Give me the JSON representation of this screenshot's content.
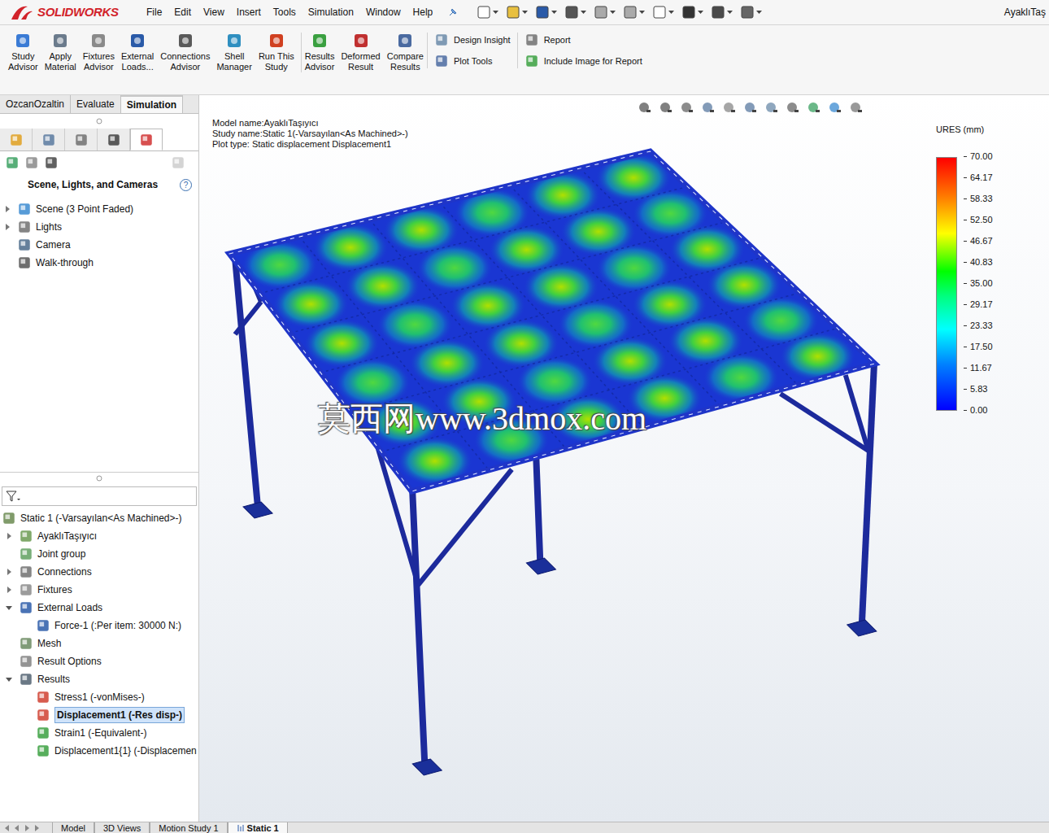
{
  "window": {
    "title": "AyaklıTaş"
  },
  "logo": {
    "brand": "SOLIDWORKS"
  },
  "menu": [
    "File",
    "Edit",
    "View",
    "Insert",
    "Tools",
    "Simulation",
    "Window",
    "Help"
  ],
  "ribbon": {
    "buttons": [
      {
        "lines": [
          "Study",
          "Advisor"
        ],
        "color": "#3a7bd5"
      },
      {
        "lines": [
          "Apply",
          "Material"
        ],
        "color": "#6b7b8c"
      },
      {
        "lines": [
          "Fixtures",
          "Advisor"
        ],
        "color": "#8a8a8a"
      },
      {
        "lines": [
          "External",
          "Loads..."
        ],
        "color": "#2a5aa8"
      },
      {
        "lines": [
          "Connections",
          "Advisor"
        ],
        "color": "#5a5a5a"
      },
      {
        "lines": [
          "Shell",
          "Manager"
        ],
        "color": "#2f8fc0"
      },
      {
        "lines": [
          "Run This",
          "Study"
        ],
        "color": "#d04020"
      },
      {
        "lines": [
          "Results",
          "Advisor"
        ],
        "color": "#3aa040"
      },
      {
        "lines": [
          "Deformed",
          "Result"
        ],
        "color": "#c03030"
      },
      {
        "lines": [
          "Compare",
          "Results"
        ],
        "color": "#4a6aa0"
      }
    ],
    "tools": [
      "Design Insight",
      "Plot Tools"
    ],
    "report": [
      "Report",
      "Include Image for Report"
    ]
  },
  "command_tabs": [
    {
      "label": "OzcanOzaltin",
      "selected": false
    },
    {
      "label": "Evaluate",
      "selected": false
    },
    {
      "label": "Simulation",
      "selected": true
    }
  ],
  "panel": {
    "tabs": [
      {
        "selected": false
      },
      {
        "selected": false
      },
      {
        "selected": false
      },
      {
        "selected": false
      },
      {
        "selected": true
      }
    ],
    "header": "Scene, Lights, and Cameras",
    "help": "?",
    "items": [
      {
        "label": "Scene (3 Point Faded)",
        "expandable": true,
        "expanded": false
      },
      {
        "label": "Lights",
        "expandable": true,
        "expanded": false
      },
      {
        "label": "Camera",
        "expandable": false,
        "expanded": false
      },
      {
        "label": "Walk-through",
        "expandable": false,
        "expanded": false
      }
    ]
  },
  "study_tree": [
    {
      "label": "Static 1 (-Varsayılan<As Machined>-)",
      "depth": 0,
      "expandable": false,
      "expanded": false,
      "selected": false
    },
    {
      "label": "AyaklıTaşıyıcı",
      "depth": 1,
      "expandable": true,
      "expanded": false,
      "selected": false
    },
    {
      "label": "Joint group",
      "depth": 1,
      "expandable": false,
      "expanded": false,
      "selected": false
    },
    {
      "label": "Connections",
      "depth": 1,
      "expandable": true,
      "expanded": false,
      "selected": false
    },
    {
      "label": "Fixtures",
      "depth": 1,
      "expandable": true,
      "expanded": false,
      "selected": false
    },
    {
      "label": "External Loads",
      "depth": 1,
      "expandable": true,
      "expanded": true,
      "selected": false
    },
    {
      "label": "Force-1 (:Per item: 30000 N:)",
      "depth": 2,
      "expandable": false,
      "expanded": false,
      "selected": false
    },
    {
      "label": "Mesh",
      "depth": 1,
      "expandable": false,
      "expanded": false,
      "selected": false
    },
    {
      "label": "Result Options",
      "depth": 1,
      "expandable": false,
      "expanded": false,
      "selected": false
    },
    {
      "label": "Results",
      "depth": 1,
      "expandable": true,
      "expanded": true,
      "selected": false
    },
    {
      "label": "Stress1 (-vonMises-)",
      "depth": 2,
      "expandable": false,
      "expanded": false,
      "selected": false
    },
    {
      "label": "Displacement1 (-Res disp-)",
      "depth": 2,
      "expandable": false,
      "expanded": false,
      "selected": true
    },
    {
      "label": "Strain1 (-Equivalent-)",
      "depth": 2,
      "expandable": false,
      "expanded": false,
      "selected": false
    },
    {
      "label": "Displacement1{1} (-Displacemen",
      "depth": 2,
      "expandable": false,
      "expanded": false,
      "selected": false
    }
  ],
  "viewport": {
    "info": [
      "Model name:AyaklıTaşıyıcı",
      "Study name:Static 1(-Varsayılan<As Machined>-)",
      "Plot type: Static displacement Displacement1"
    ],
    "legend": {
      "title": "URES (mm)",
      "ticks": [
        "70.00",
        "64.17",
        "58.33",
        "52.50",
        "46.67",
        "40.83",
        "35.00",
        "29.17",
        "23.33",
        "17.50",
        "11.67",
        "5.83",
        "0.00"
      ]
    },
    "watermark": "莫西网www.3dmox.com"
  },
  "bottom_tabs": [
    {
      "label": "Model",
      "selected": false
    },
    {
      "label": "3D Views",
      "selected": false
    },
    {
      "label": "Motion Study 1",
      "selected": false
    },
    {
      "label": "Static 1",
      "selected": true
    }
  ]
}
